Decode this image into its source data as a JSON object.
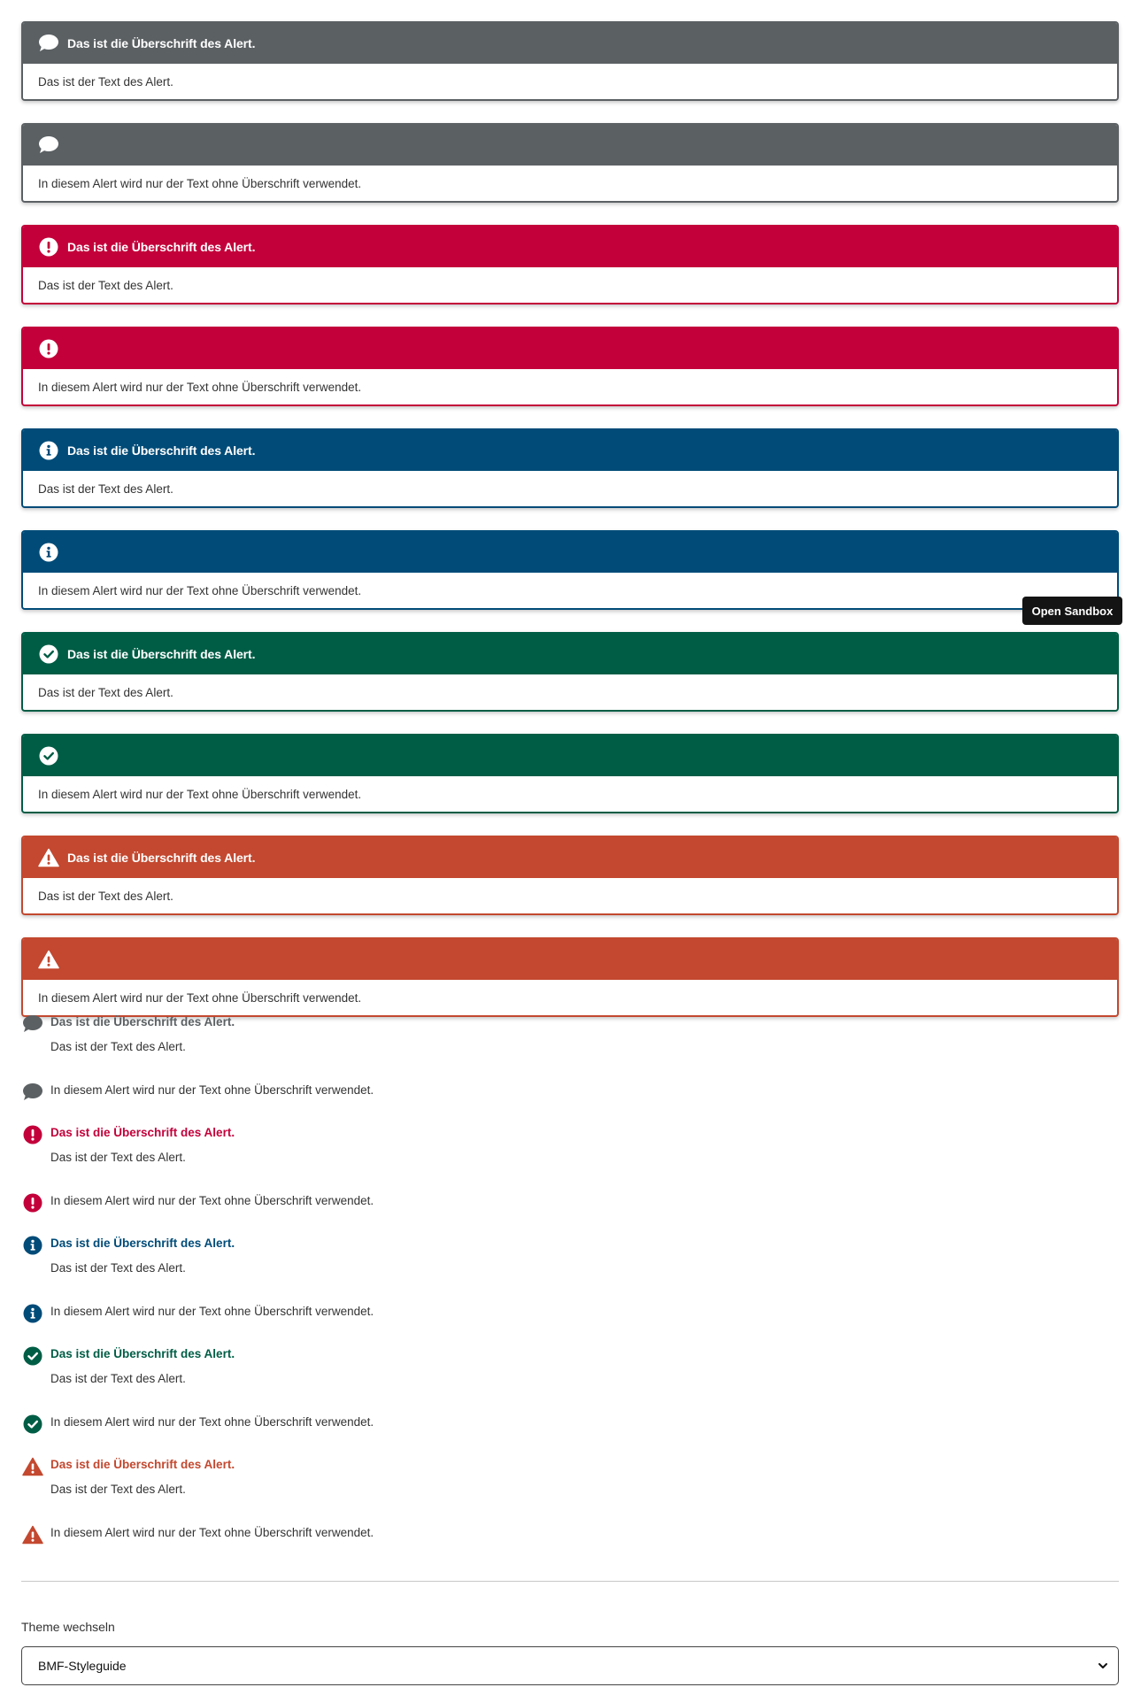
{
  "colors": {
    "neutral": "#5b6063",
    "error": "#c3003a",
    "info": "#004b78",
    "success": "#005d45",
    "warning": "#c3482f"
  },
  "alerts_boxed": [
    {
      "variant": "neutral",
      "icon": "chat-bubble-icon",
      "title": "Das ist die Überschrift des Alert.",
      "text": "Das ist der Text des Alert."
    },
    {
      "variant": "neutral",
      "icon": "chat-bubble-icon",
      "title": "",
      "text": "In diesem Alert wird nur der Text ohne Überschrift verwendet."
    },
    {
      "variant": "error",
      "icon": "exclamation-circle-icon",
      "title": "Das ist die Überschrift des Alert.",
      "text": "Das ist der Text des Alert."
    },
    {
      "variant": "error",
      "icon": "exclamation-circle-icon",
      "title": "",
      "text": "In diesem Alert wird nur der Text ohne Überschrift verwendet."
    },
    {
      "variant": "info",
      "icon": "info-circle-icon",
      "title": "Das ist die Überschrift des Alert.",
      "text": "Das ist der Text des Alert."
    },
    {
      "variant": "info",
      "icon": "info-circle-icon",
      "title": "",
      "text": "In diesem Alert wird nur der Text ohne Überschrift verwendet."
    },
    {
      "variant": "success",
      "icon": "check-circle-icon",
      "title": "Das ist die Überschrift des Alert.",
      "text": "Das ist der Text des Alert."
    },
    {
      "variant": "success",
      "icon": "check-circle-icon",
      "title": "",
      "text": "In diesem Alert wird nur der Text ohne Überschrift verwendet."
    },
    {
      "variant": "warning",
      "icon": "warning-triangle-icon",
      "title": "Das ist die Überschrift des Alert.",
      "text": "Das ist der Text des Alert."
    },
    {
      "variant": "warning",
      "icon": "warning-triangle-icon",
      "title": "",
      "text": "In diesem Alert wird nur der Text ohne Überschrift verwendet."
    }
  ],
  "tooltip": {
    "label": "Open Sandbox"
  },
  "alerts_inline": [
    {
      "variant": "neutral",
      "icon": "chat-bubble-icon",
      "title": "Das ist die Überschrift des Alert.",
      "text": "Das ist der Text des Alert."
    },
    {
      "variant": "neutral",
      "icon": "chat-bubble-icon",
      "title": "",
      "text": "In diesem Alert wird nur der Text ohne Überschrift verwendet."
    },
    {
      "variant": "error",
      "icon": "exclamation-circle-icon",
      "title": "Das ist die Überschrift des Alert.",
      "text": "Das ist der Text des Alert."
    },
    {
      "variant": "error",
      "icon": "exclamation-circle-icon",
      "title": "",
      "text": "In diesem Alert wird nur der Text ohne Überschrift verwendet."
    },
    {
      "variant": "info",
      "icon": "info-circle-icon",
      "title": "Das ist die Überschrift des Alert.",
      "text": "Das ist der Text des Alert."
    },
    {
      "variant": "info",
      "icon": "info-circle-icon",
      "title": "",
      "text": "In diesem Alert wird nur der Text ohne Überschrift verwendet."
    },
    {
      "variant": "success",
      "icon": "check-circle-icon",
      "title": "Das ist die Überschrift des Alert.",
      "text": "Das ist der Text des Alert."
    },
    {
      "variant": "success",
      "icon": "check-circle-icon",
      "title": "",
      "text": "In diesem Alert wird nur der Text ohne Überschrift verwendet."
    },
    {
      "variant": "warning",
      "icon": "warning-triangle-icon",
      "title": "Das ist die Überschrift des Alert.",
      "text": "Das ist der Text des Alert."
    },
    {
      "variant": "warning",
      "icon": "warning-triangle-icon",
      "title": "",
      "text": "In diesem Alert wird nur der Text ohne Überschrift verwendet."
    }
  ],
  "theme": {
    "label": "Theme wechseln",
    "selected": "BMF-Styleguide"
  }
}
